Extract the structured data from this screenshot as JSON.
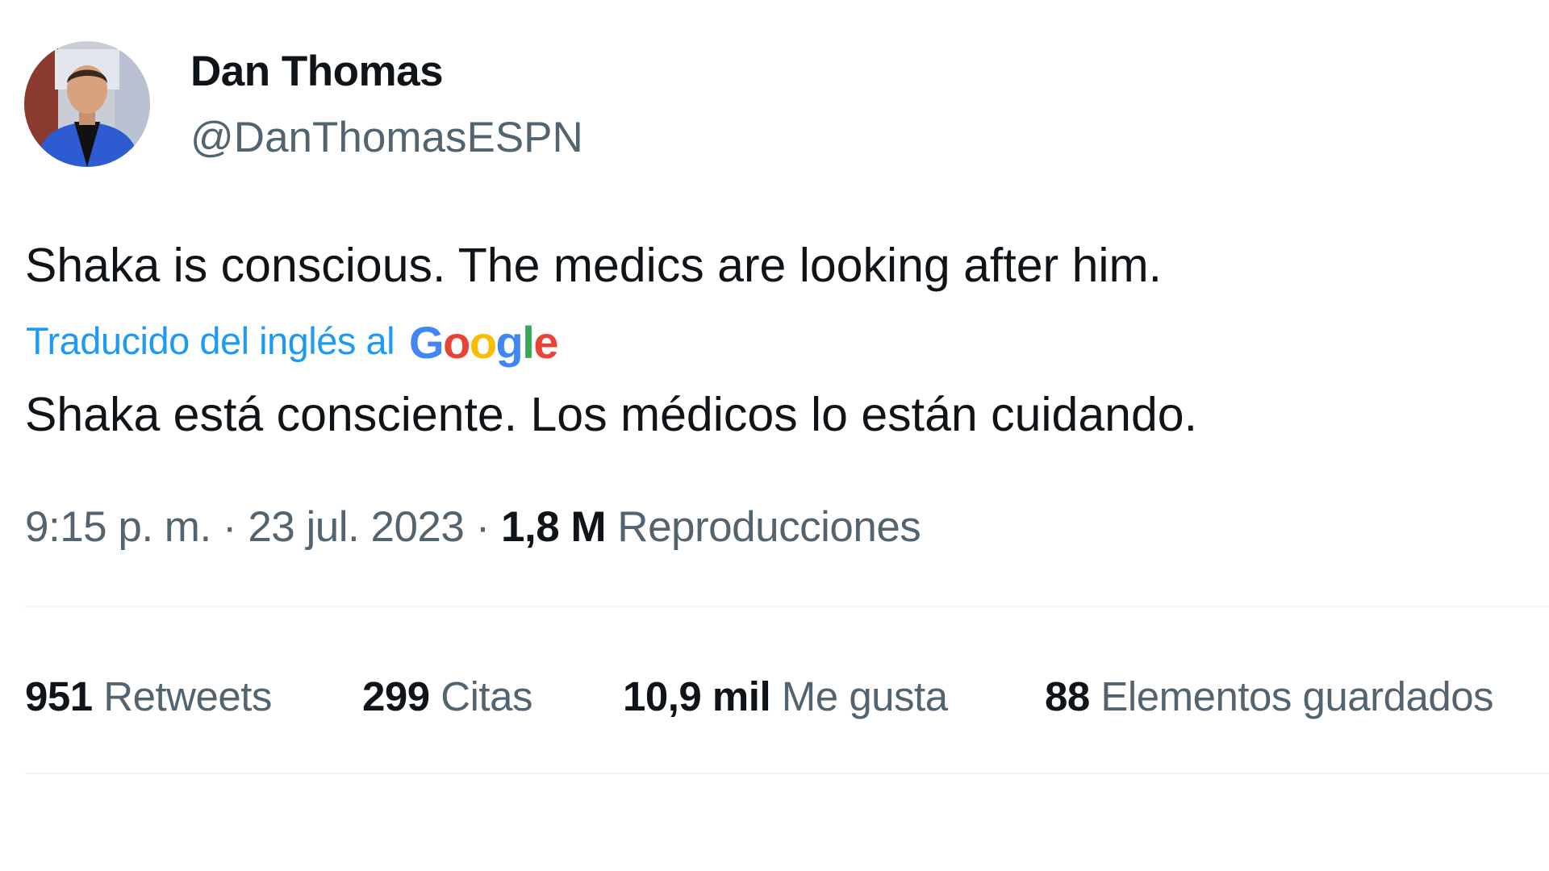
{
  "author": {
    "name": "Dan Thomas",
    "handle": "@DanThomasESPN"
  },
  "tweet": {
    "text": "Shaka is conscious. The medics are looking after him.",
    "translation_label": "Traducido del inglés al",
    "translation_provider": "Google",
    "translated_text": "Shaka está consciente. Los médicos lo están cuidando."
  },
  "meta": {
    "time": "9:15 p. m.",
    "separator": "·",
    "date": "23 jul. 2023",
    "views_count": "1,8 M",
    "views_label": "Reproducciones"
  },
  "stats": {
    "retweets": {
      "count": "951",
      "label": "Retweets"
    },
    "quotes": {
      "count": "299",
      "label": "Citas"
    },
    "likes": {
      "count": "10,9 mil",
      "label": "Me gusta"
    },
    "bookmarks": {
      "count": "88",
      "label": "Elementos guardados"
    }
  },
  "colors": {
    "primary_text": "#0f1419",
    "secondary_text": "#536471",
    "link": "#1d9bf0",
    "divider": "#eff3f4"
  }
}
